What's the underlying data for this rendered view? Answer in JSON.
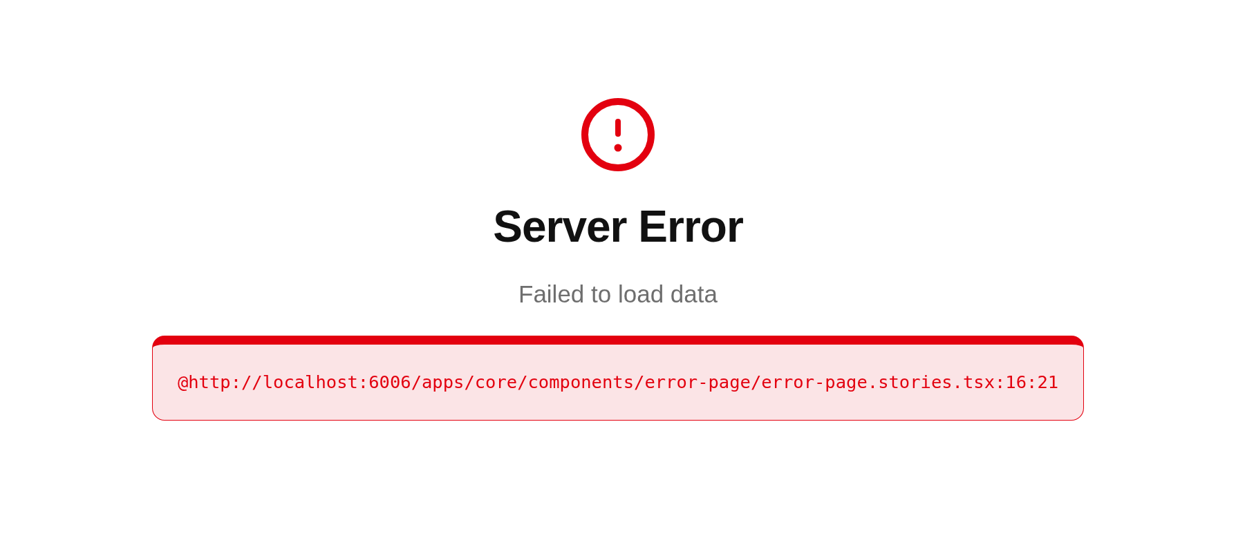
{
  "error": {
    "title": "Server Error",
    "message": "Failed to load data",
    "details": "@http://localhost:6006/apps/core/components/error-page/error-page.stories.tsx:16:21"
  }
}
